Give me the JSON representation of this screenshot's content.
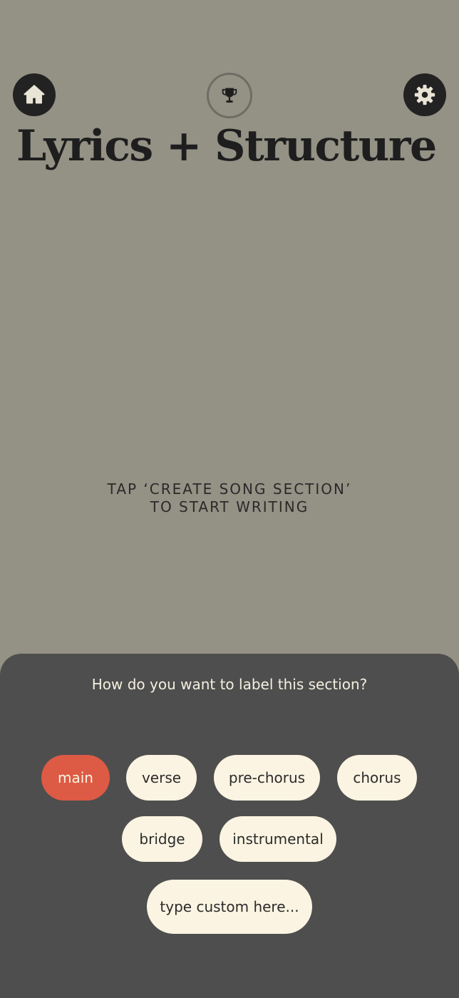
{
  "header": {
    "title": "Lyrics + Structure"
  },
  "icons": {
    "home": "home-icon",
    "trophy": "trophy-icon",
    "settings": "gear-icon"
  },
  "empty_state": {
    "line1": "TAP ‘CREATE SONG SECTION’",
    "line2": "TO START WRITING"
  },
  "label_sheet": {
    "prompt": "How do you want to label this section?",
    "options": [
      "main",
      "verse",
      "pre-chorus",
      "chorus",
      "bridge",
      "instrumental"
    ],
    "selected": "main",
    "custom_placeholder": "type custom here..."
  },
  "colors": {
    "background": "#949185",
    "sheet": "#4e4e4e",
    "chip": "#fbf4e2",
    "chip_selected": "#dd5a44",
    "dark": "#232222"
  }
}
